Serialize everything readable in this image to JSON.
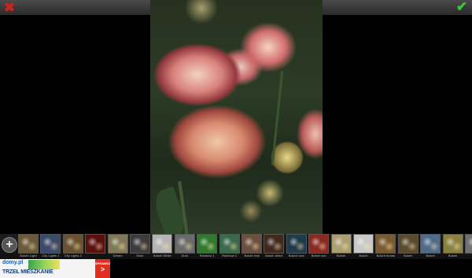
{
  "toolbar": {
    "close_icon": "close-icon",
    "accept_icon": "checkmark-icon",
    "flip_horizontal_icon": "flip-horizontal-icon",
    "flip_vertical_icon": "flip-vertical-icon",
    "close_glyph": "✖",
    "accept_glyph": "✔"
  },
  "filters": {
    "add_label": "+",
    "items": [
      {
        "label": "Bokeh Light",
        "swatch": "#6b5a3a"
      },
      {
        "label": "City Lights 1",
        "swatch": "#3b4a6a"
      },
      {
        "label": "City Lights 2",
        "swatch": "#6a5230"
      },
      {
        "label": "",
        "swatch": "#5a1010"
      },
      {
        "label": "Dream",
        "swatch": "#807858"
      },
      {
        "label": "Mute",
        "swatch": "#3c3c3c"
      },
      {
        "label": "Bokeh White",
        "swatch": "#b4b4b4"
      },
      {
        "label": "Dust",
        "swatch": "#6a6a6a"
      },
      {
        "label": "Rainbow 1",
        "swatch": "#2f7a2f"
      },
      {
        "label": "Rainbow 2",
        "swatch": "#3a6a4a"
      },
      {
        "label": "Bokeh real",
        "swatch": "#6a5040"
      },
      {
        "label": "Bokeh direct",
        "swatch": "#402a20"
      },
      {
        "label": "Bokeh cars",
        "swatch": "#1f3a4a"
      },
      {
        "label": "Bokeh sun",
        "swatch": "#8a2a22"
      },
      {
        "label": "Bokeh",
        "swatch": "#a8a070"
      },
      {
        "label": "Bokeh",
        "swatch": "#c8c8c8"
      },
      {
        "label": "Bokeh hearts",
        "swatch": "#7a5a30"
      },
      {
        "label": "Bokeh",
        "swatch": "#5a4a30"
      },
      {
        "label": "Bokeh",
        "swatch": "#506a8a"
      },
      {
        "label": "Bokeh",
        "swatch": "#8a8040"
      },
      {
        "label": "B",
        "swatch": "#707070"
      }
    ]
  },
  "ad": {
    "logo": "domy.pl",
    "headline": "TRZEŁ  MIESZKANIE",
    "phone": "",
    "cta_text": "SPRAWDŹ",
    "cta_arrow": ">"
  }
}
